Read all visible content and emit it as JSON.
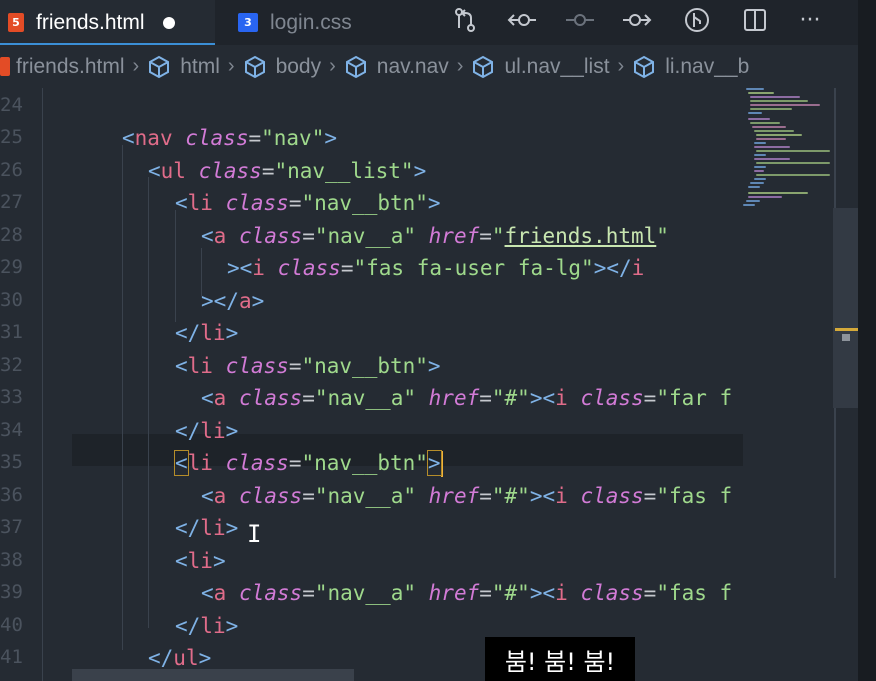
{
  "tabs": [
    {
      "label": "friends.html",
      "type": "html",
      "modified": true,
      "active": true
    },
    {
      "label": "login.css",
      "type": "css",
      "modified": false,
      "active": false
    }
  ],
  "editor_actions": [
    {
      "icon": "source-control-icon"
    },
    {
      "icon": "go-back-icon"
    },
    {
      "icon": "commit-icon"
    },
    {
      "icon": "go-forward-icon"
    },
    {
      "icon": "git-graph-icon"
    },
    {
      "icon": "split-editor-icon"
    },
    {
      "icon": "more-actions-icon",
      "glyph": "···"
    }
  ],
  "breadcrumb": [
    "friends.html",
    "html",
    "body",
    "nav.nav",
    "ul.nav__list",
    "li.nav__b"
  ],
  "line_numbers": [
    "24",
    "25",
    "26",
    "27",
    "28",
    "29",
    "30",
    "31",
    "32",
    "33",
    "34",
    "35",
    "36",
    "37",
    "38",
    "39",
    "40",
    "41"
  ],
  "code": {
    "nav_open": "nav",
    "attr_class": "class",
    "attr_href": "href",
    "val_nav": "\"nav\"",
    "ul": "ul",
    "val_nav_list": "\"nav__list\"",
    "li": "li",
    "val_nav_btn": "\"nav__btn\"",
    "a": "a",
    "val_nav_a": "\"nav__a\"",
    "val_friends": "friends.html",
    "i": "i",
    "val_fas_user": "\"fas fa-user fa-lg\"",
    "val_hash": "\"#\"",
    "val_far_f": "\"far f",
    "val_fas_f": "\"fas f"
  },
  "caption": "붐! 붐! 붐!",
  "colors": {
    "background": "#252b33",
    "tag": "#e06c8a",
    "attribute": "#d27bd6",
    "string": "#9fd98c",
    "bracket": "#7fb2e6",
    "cursor": "#f0b23a",
    "html_icon": "#e34c26",
    "css_icon": "#2965f1"
  }
}
